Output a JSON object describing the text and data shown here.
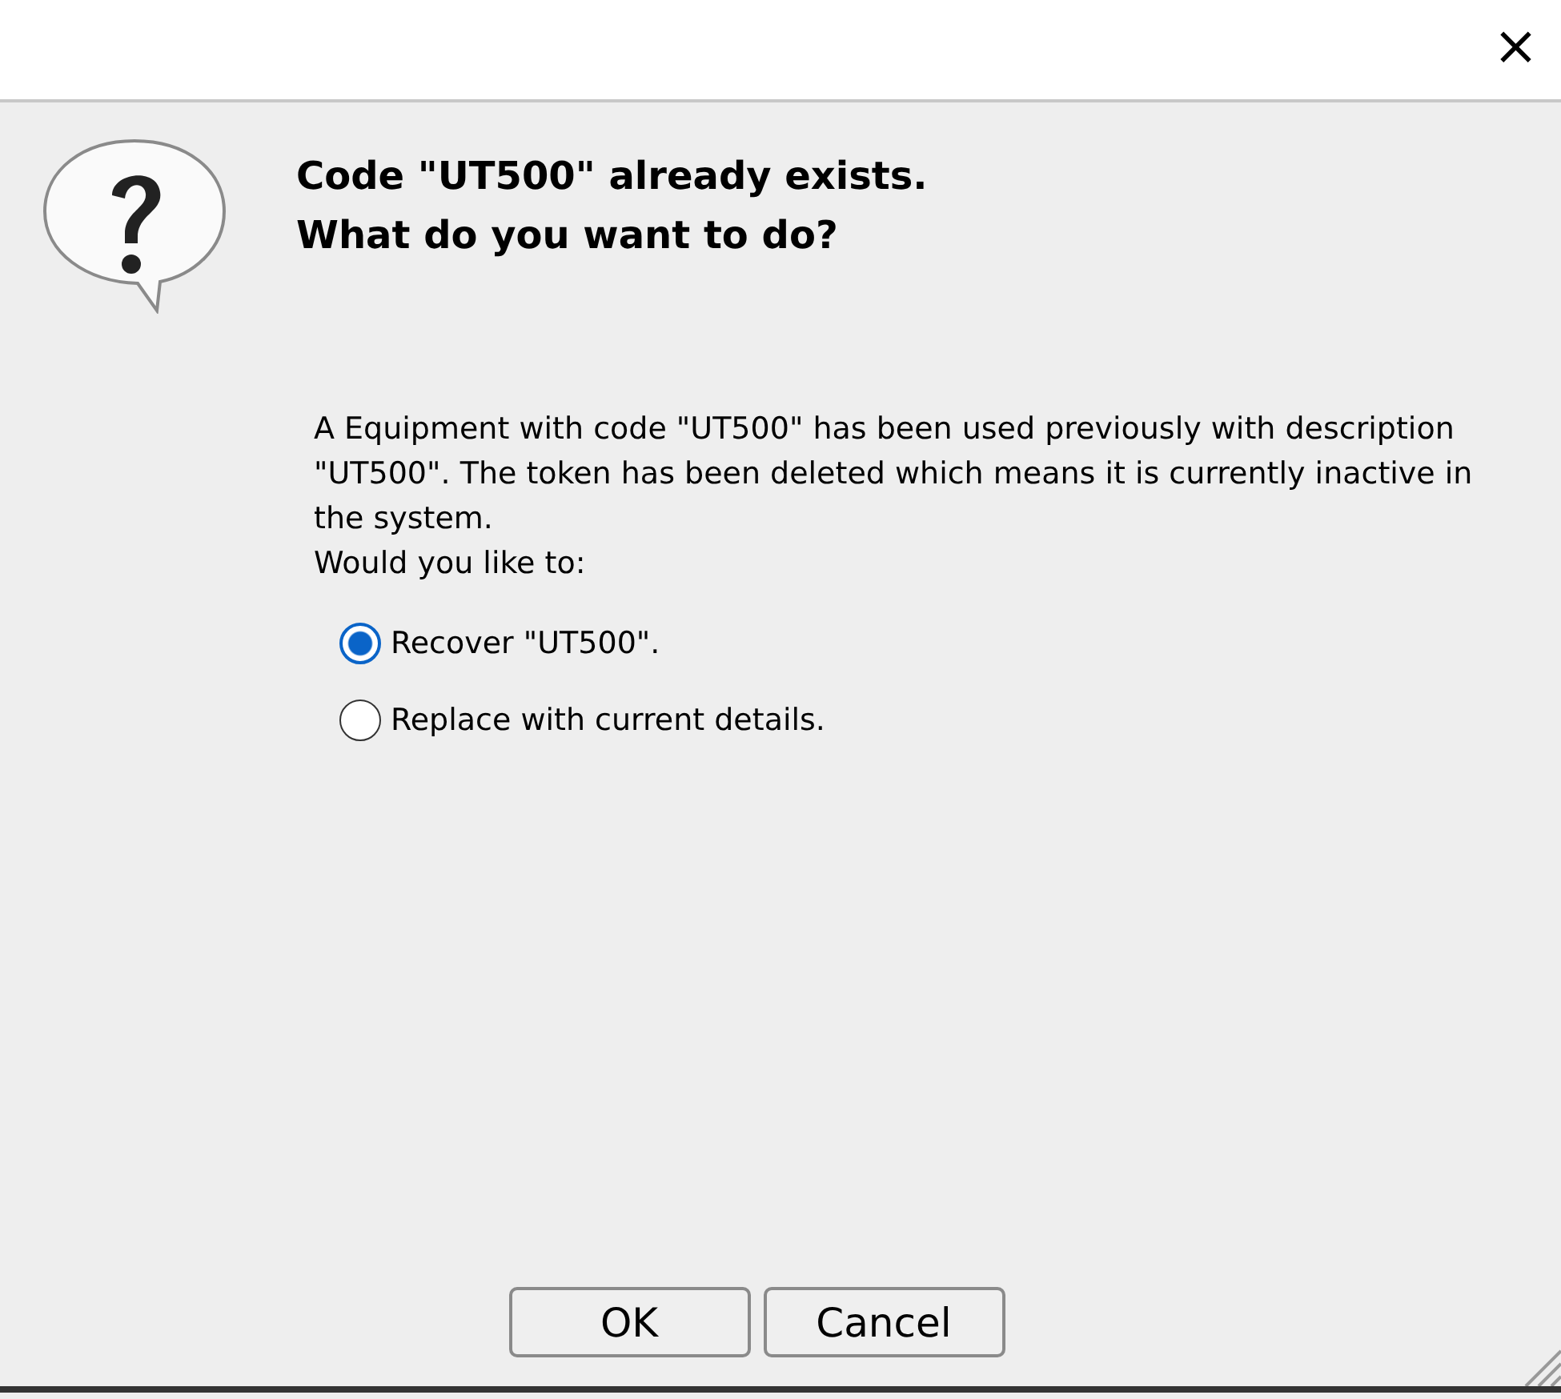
{
  "window": {
    "close_symbol": "×"
  },
  "heading": [
    "Code \"UT500\" already exists.",
    "What do you want to do?"
  ],
  "message": "A Equipment with code \"UT500\" has been used previously with description \"UT500\". The token has been deleted which means it is currently inactive in the system.",
  "prompt": "Would you like to:",
  "options": [
    {
      "label": "Recover \"UT500\".",
      "selected": true
    },
    {
      "label": "Replace with current details.",
      "selected": false
    }
  ],
  "buttons": [
    "OK",
    "Cancel"
  ]
}
